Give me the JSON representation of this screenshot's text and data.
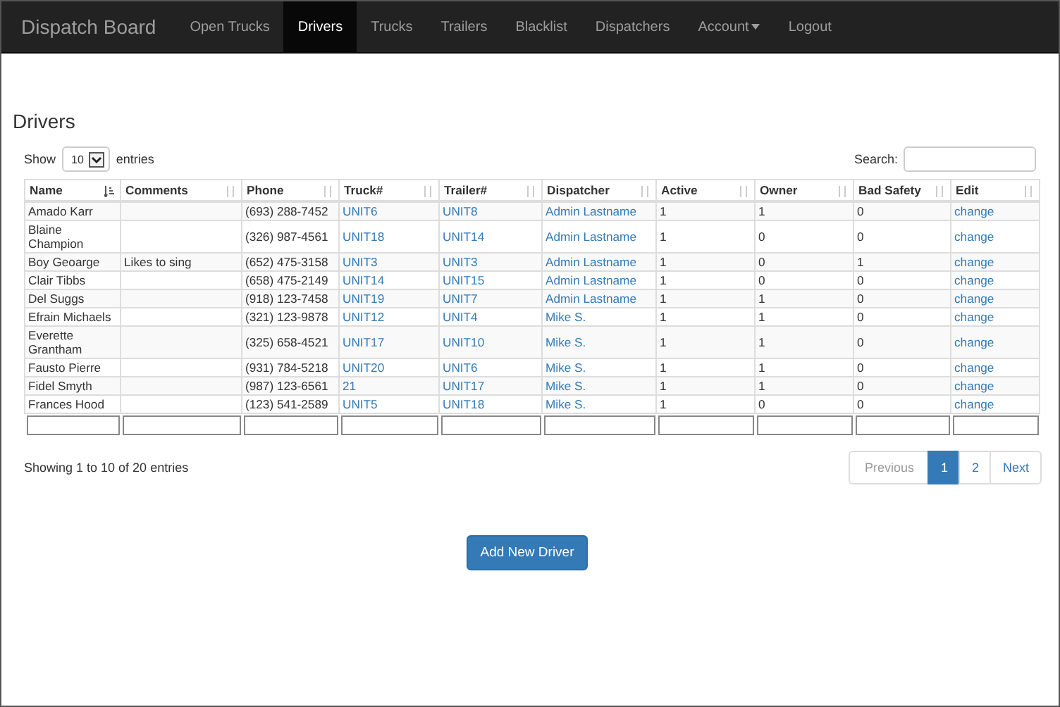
{
  "navbar": {
    "brand": "Dispatch Board",
    "items": [
      {
        "label": "Open Trucks",
        "selected": false,
        "dropdown": false
      },
      {
        "label": "Drivers",
        "selected": true,
        "dropdown": false
      },
      {
        "label": "Trucks",
        "selected": false,
        "dropdown": false
      },
      {
        "label": "Trailers",
        "selected": false,
        "dropdown": false
      },
      {
        "label": "Blacklist",
        "selected": false,
        "dropdown": false
      },
      {
        "label": "Dispatchers",
        "selected": false,
        "dropdown": false
      },
      {
        "label": "Account",
        "selected": false,
        "dropdown": true
      },
      {
        "label": "Logout",
        "selected": false,
        "dropdown": false
      }
    ]
  },
  "page_title": "Drivers",
  "length_control": {
    "before": "Show",
    "value": "10",
    "after": "entries"
  },
  "search": {
    "label": "Search:"
  },
  "table": {
    "columns": [
      {
        "label": "Name",
        "sorted": true,
        "kind": "text"
      },
      {
        "label": "Comments",
        "sorted": false,
        "kind": "text"
      },
      {
        "label": "Phone",
        "sorted": false,
        "kind": "text"
      },
      {
        "label": "Truck#",
        "sorted": false,
        "kind": "link"
      },
      {
        "label": "Trailer#",
        "sorted": false,
        "kind": "link"
      },
      {
        "label": "Dispatcher",
        "sorted": false,
        "kind": "link"
      },
      {
        "label": "Active",
        "sorted": false,
        "kind": "text"
      },
      {
        "label": "Owner",
        "sorted": false,
        "kind": "text"
      },
      {
        "label": "Bad Safety",
        "sorted": false,
        "kind": "text"
      },
      {
        "label": "Edit",
        "sorted": false,
        "kind": "link"
      }
    ],
    "rows": [
      [
        "Amado Karr",
        "",
        "(693) 288-7452",
        "UNIT6",
        "UNIT8",
        "Admin Lastname",
        "1",
        "1",
        "0",
        "change"
      ],
      [
        "Blaine Champion",
        "",
        "(326) 987-4561",
        "UNIT18",
        "UNIT14",
        "Admin Lastname",
        "1",
        "0",
        "0",
        "change"
      ],
      [
        "Boy Geoarge",
        "Likes to sing",
        "(652) 475-3158",
        "UNIT3",
        "UNIT3",
        "Admin Lastname",
        "1",
        "0",
        "1",
        "change"
      ],
      [
        "Clair Tibbs",
        "",
        "(658) 475-2149",
        "UNIT14",
        "UNIT15",
        "Admin Lastname",
        "1",
        "0",
        "0",
        "change"
      ],
      [
        "Del Suggs",
        "",
        "(918) 123-7458",
        "UNIT19",
        "UNIT7",
        "Admin Lastname",
        "1",
        "1",
        "0",
        "change"
      ],
      [
        "Efrain Michaels",
        "",
        "(321) 123-9878",
        "UNIT12",
        "UNIT4",
        "Mike S.",
        "1",
        "1",
        "0",
        "change"
      ],
      [
        "Everette Grantham",
        "",
        "(325) 658-4521",
        "UNIT17",
        "UNIT10",
        "Mike S.",
        "1",
        "1",
        "0",
        "change"
      ],
      [
        "Fausto Pierre",
        "",
        "(931) 784-5218",
        "UNIT20",
        "UNIT6",
        "Mike S.",
        "1",
        "1",
        "0",
        "change"
      ],
      [
        "Fidel Smyth",
        "",
        "(987) 123-6561",
        "21",
        "UNIT17",
        "Mike S.",
        "1",
        "1",
        "0",
        "change"
      ],
      [
        "Frances Hood",
        "",
        "(123) 541-2589",
        "UNIT5",
        "UNIT18",
        "Mike S.",
        "1",
        "0",
        "0",
        "change"
      ]
    ]
  },
  "info": "Showing 1 to 10 of 20 entries",
  "pagination": [
    {
      "label": "Previous",
      "selected": false,
      "disabled": true
    },
    {
      "label": "1",
      "selected": true,
      "disabled": false
    },
    {
      "label": "2",
      "selected": false,
      "disabled": false
    },
    {
      "label": "Next",
      "selected": false,
      "disabled": false
    }
  ],
  "add_button": "Add New Driver"
}
